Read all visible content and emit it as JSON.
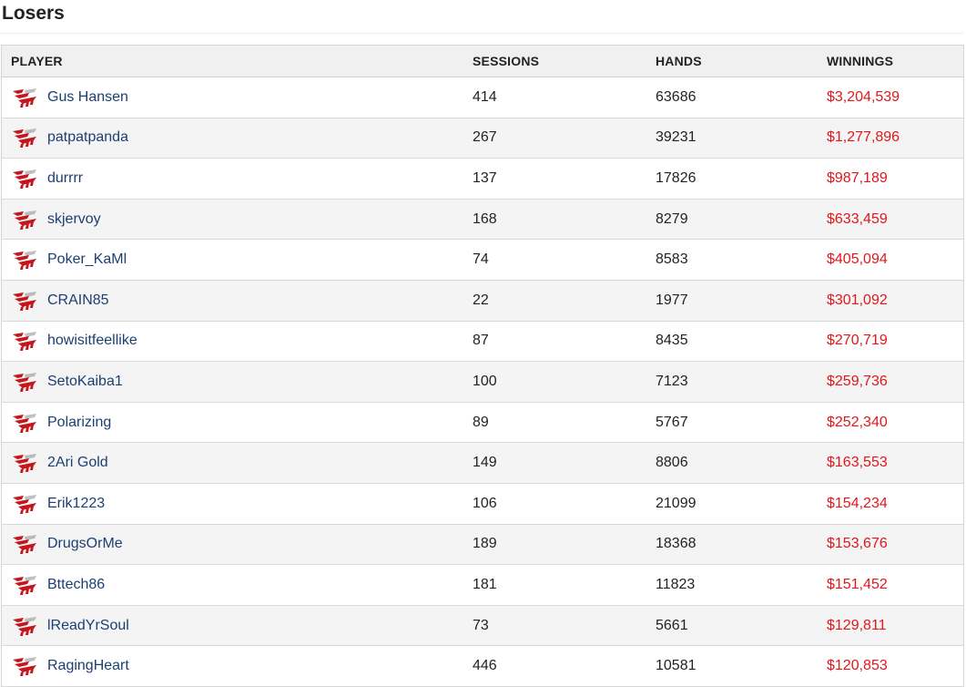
{
  "page": {
    "title": "Losers"
  },
  "table": {
    "headers": {
      "player": "PLAYER",
      "sessions": "SESSIONS",
      "hands": "HANDS",
      "winnings": "WINNINGS"
    },
    "rows": [
      {
        "player": "Gus Hansen",
        "sessions": "414",
        "hands": "63686",
        "winnings": "$3,204,539"
      },
      {
        "player": "patpatpanda",
        "sessions": "267",
        "hands": "39231",
        "winnings": "$1,277,896"
      },
      {
        "player": "durrrr",
        "sessions": "137",
        "hands": "17826",
        "winnings": "$987,189"
      },
      {
        "player": "skjervoy",
        "sessions": "168",
        "hands": "8279",
        "winnings": "$633,459"
      },
      {
        "player": "Poker_KaMl",
        "sessions": "74",
        "hands": "8583",
        "winnings": "$405,094"
      },
      {
        "player": "CRAIN85",
        "sessions": "22",
        "hands": "1977",
        "winnings": "$301,092"
      },
      {
        "player": "howisitfeellike",
        "sessions": "87",
        "hands": "8435",
        "winnings": "$270,719"
      },
      {
        "player": "SetoKaiba1",
        "sessions": "100",
        "hands": "7123",
        "winnings": "$259,736"
      },
      {
        "player": "Polarizing",
        "sessions": "89",
        "hands": "5767",
        "winnings": "$252,340"
      },
      {
        "player": "2Ari Gold",
        "sessions": "149",
        "hands": "8806",
        "winnings": "$163,553"
      },
      {
        "player": "Erik1223",
        "sessions": "106",
        "hands": "21099",
        "winnings": "$154,234"
      },
      {
        "player": "DrugsOrMe",
        "sessions": "189",
        "hands": "18368",
        "winnings": "$153,676"
      },
      {
        "player": "Bttech86",
        "sessions": "181",
        "hands": "11823",
        "winnings": "$151,452"
      },
      {
        "player": "lReadYrSoul",
        "sessions": "73",
        "hands": "5661",
        "winnings": "$129,811"
      },
      {
        "player": "RagingHeart",
        "sessions": "446",
        "hands": "10581",
        "winnings": "$120,853"
      }
    ]
  },
  "icons": {
    "site_logo": "full-tilt-poker-logo-icon"
  },
  "colors": {
    "player_link": "#1c3f73",
    "winnings_negative": "#e3161b",
    "logo_red": "#c4161c"
  }
}
